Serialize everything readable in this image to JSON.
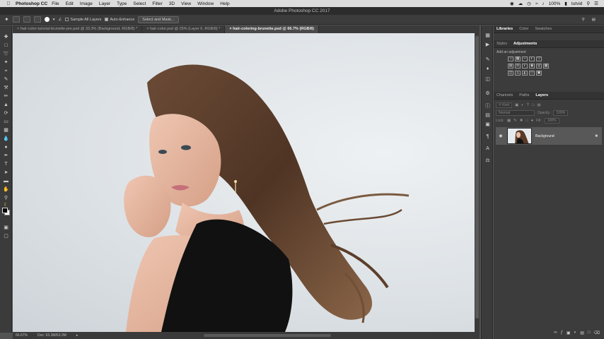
{
  "menubar": {
    "apple_icon": "apple-logo",
    "app_name": "Photoshop CC",
    "items": [
      "File",
      "Edit",
      "Image",
      "Layer",
      "Type",
      "Select",
      "Filter",
      "3D",
      "View",
      "Window",
      "Help"
    ],
    "battery": "100%",
    "user": "tutvid"
  },
  "window": {
    "title": "Adobe Photoshop CC 2017"
  },
  "options_bar": {
    "sample_all_layers": "Sample All Layers",
    "auto_enhance": "Auto-Enhance",
    "select_and_mask": "Select and Mask..."
  },
  "doc_tabs": [
    {
      "label": "hair-color-tutorial-brunette-pre.psd @ 33.3% (Background, RGB/8) *",
      "active": false
    },
    {
      "label": "hair-color.psd @ 25% (Layer 6, RGB/8) *",
      "active": false
    },
    {
      "label": "hair-coloring-brunette.psd @ 66.7% (RGB/8)",
      "active": true
    }
  ],
  "status": {
    "zoom": "66.67%",
    "doc": "Doc: 63.3M/63.3M"
  },
  "panels": {
    "top_tabs": [
      "Libraries",
      "Color",
      "Swatches"
    ],
    "adj_tabs": [
      "Styles",
      "Adjustments"
    ],
    "adj_hint": "Add an adjustment",
    "layer_tabs": [
      "Channels",
      "Paths",
      "Layers"
    ],
    "filter_kind": "Kind",
    "blend_mode": "Normal",
    "opacity_label": "Opacity:",
    "opacity_value": "100%",
    "lock_label": "Lock:",
    "fill_label": "Fill:",
    "fill_value": "100%",
    "background_layer": "Background"
  },
  "colors": {
    "menubar_bg": "#dcdcdc",
    "ui_dark": "#3c3c3c",
    "canvas_bg": "#dde2e6"
  }
}
